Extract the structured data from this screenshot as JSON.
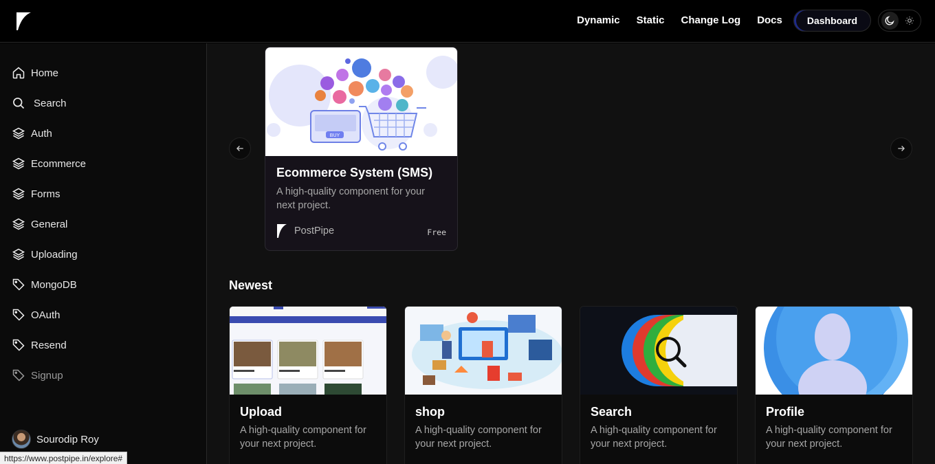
{
  "header": {
    "nav": [
      "Dynamic",
      "Static",
      "Change Log",
      "Docs"
    ],
    "dashboard_label": "Dashboard"
  },
  "sidebar": {
    "items": [
      {
        "label": "Home",
        "icon": "home-icon"
      },
      {
        "label": "Search",
        "icon": "search-icon"
      },
      {
        "label": "Auth",
        "icon": "layers-icon"
      },
      {
        "label": "Ecommerce",
        "icon": "layers-icon"
      },
      {
        "label": "Forms",
        "icon": "layers-icon"
      },
      {
        "label": "General",
        "icon": "layers-icon"
      },
      {
        "label": "Uploading",
        "icon": "layers-icon"
      },
      {
        "label": "MongoDB",
        "icon": "tag-icon"
      },
      {
        "label": "OAuth",
        "icon": "tag-icon"
      },
      {
        "label": "Resend",
        "icon": "tag-icon"
      },
      {
        "label": "Signup",
        "icon": "tag-icon"
      }
    ],
    "user": {
      "name": "Sourodip Roy"
    }
  },
  "featured": {
    "title": "Ecommerce System (SMS)",
    "description": "A high-quality component for your next project.",
    "brand": "PostPipe",
    "price": "Free",
    "image_button": "BUY"
  },
  "newest": {
    "heading": "Newest",
    "cards": [
      {
        "title": "Upload",
        "description": "A high-quality component for your next project."
      },
      {
        "title": "shop",
        "description": "A high-quality component for your next project."
      },
      {
        "title": "Search",
        "description": "A high-quality component for your next project."
      },
      {
        "title": "Profile",
        "description": "A high-quality component for your next project."
      }
    ]
  },
  "status_url": "https://www.postpipe.in/explore#",
  "colors": {
    "accent": "#1e2a8a",
    "background": "#111111"
  }
}
